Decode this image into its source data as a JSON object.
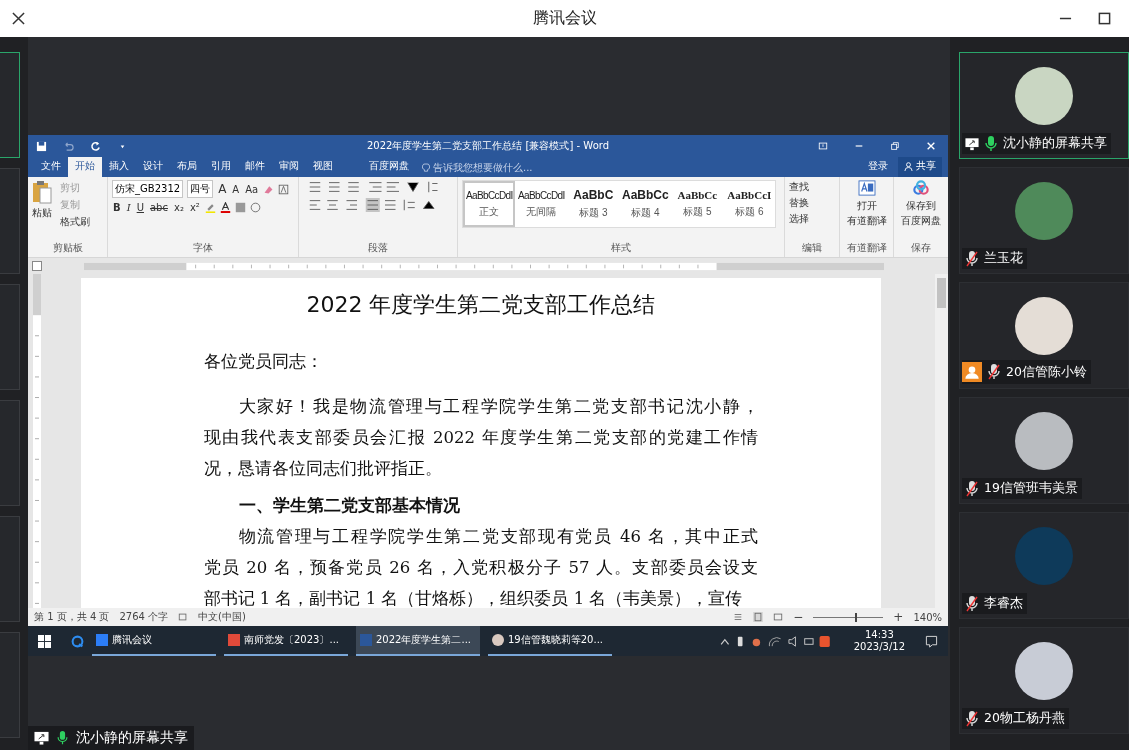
{
  "app": {
    "title": "腾讯会议"
  },
  "word": {
    "title": "2022年度学生第二党支部工作总结 [兼容模式] - Word",
    "tabs": [
      {
        "label": "文件",
        "selected": false
      },
      {
        "label": "开始",
        "selected": true
      },
      {
        "label": "插入",
        "selected": false
      },
      {
        "label": "设计",
        "selected": false
      },
      {
        "label": "布局",
        "selected": false
      },
      {
        "label": "引用",
        "selected": false
      },
      {
        "label": "邮件",
        "selected": false
      },
      {
        "label": "审阅",
        "selected": false
      },
      {
        "label": "视图",
        "selected": false
      },
      {
        "label": "百度网盘",
        "selected": false
      }
    ],
    "tell_me": {
      "placeholder": "告诉我您想要做什么..."
    },
    "sign_in": "登录",
    "share": "共享",
    "clipboard": {
      "paste": "粘贴",
      "items": [
        "剪切",
        "复制",
        "格式刷"
      ],
      "label": "剪贴板"
    },
    "font": {
      "name": "仿宋_GB2312",
      "size": "四号",
      "row1": [
        "A",
        "A",
        "Aa"
      ],
      "row2": [
        "B",
        "I",
        "U",
        "abc",
        "x₂",
        "x²"
      ],
      "label": "字体"
    },
    "paragraph": {
      "label": "段落"
    },
    "styles": {
      "items": [
        {
          "preview": "AaBbCcDdI",
          "name": "正文",
          "kind": "body",
          "selected": true
        },
        {
          "preview": "AaBbCcDdI",
          "name": "无间隔",
          "kind": "body",
          "selected": false
        },
        {
          "preview": "AaBbC",
          "name": "标题 3",
          "kind": "heading",
          "selected": false
        },
        {
          "preview": "AaBbCc",
          "name": "标题 4",
          "kind": "heading",
          "selected": false
        },
        {
          "preview": "AaBbCc",
          "name": "标题 5",
          "kind": "subheading",
          "selected": false
        },
        {
          "preview": "AaBbCcI",
          "name": "标题 6",
          "kind": "subheading",
          "selected": false
        }
      ],
      "label": "样式"
    },
    "editing": {
      "items": [
        "查找",
        "替换",
        "选择"
      ],
      "label": "编辑"
    },
    "translate": {
      "button": "打开",
      "sub": "有道翻译",
      "label": "有道翻译"
    },
    "save": {
      "button": "保存到",
      "sub": "百度网盘",
      "label": "保存"
    },
    "document": {
      "title": "2022 年度学生第二党支部工作总结",
      "paragraphs": [
        {
          "kind": "salutation",
          "lines": [
            "各位党员同志："
          ]
        },
        {
          "kind": "body",
          "lines": [
            "大家好！我是物流管理与工程学院学生第二党支部书记沈小静，",
            "现由我代表支部委员会汇报 2022 年度学生第二党支部的党建工作情",
            "况，恳请各位同志们批评指正。"
          ]
        },
        {
          "kind": "heading",
          "lines": [
            "一、学生第二党支部基本情况"
          ]
        },
        {
          "kind": "body",
          "lines": [
            "物流管理与工程学院学生第二党支部现有党员 46 名，其中正式",
            "党员 20 名，预备党员 26 名，入党积极分子 57 人。支部委员会设支",
            "部书记 1 名，副书记 1 名（甘烙栎），组织委员 1 名（韦美景），宣传"
          ]
        }
      ]
    },
    "status": {
      "page": "第 1 页，共 4 页",
      "words": "2764 个字",
      "language": "中文(中国)",
      "zoom": "140%",
      "zoom_out": "−",
      "zoom_in": "+",
      "zoom_level": {
        "level": 0.6
      }
    }
  },
  "taskbar": {
    "apps": [
      {
        "label": "腾讯会议",
        "kind": "meeting",
        "selected": false
      },
      {
        "label": "南师党发〔2023〕...",
        "kind": "pdf",
        "selected": false
      },
      {
        "label": "2022年度学生第二...",
        "kind": "word",
        "selected": true
      },
      {
        "label": "19信管魏晓莉等20...",
        "kind": "photo",
        "selected": false
      }
    ],
    "time": "14:33",
    "date": "2023/3/12"
  },
  "participants": [
    {
      "name": "沈小静的屏幕共享",
      "sharing": true,
      "muted": false,
      "person_badge": false,
      "selected": true,
      "color": "#c9d6c2"
    },
    {
      "name": "兰玉花",
      "sharing": false,
      "muted": true,
      "person_badge": false,
      "selected": false,
      "color": "#4f8a5a"
    },
    {
      "name": "20信管陈小铃",
      "sharing": false,
      "muted": true,
      "person_badge": true,
      "selected": false,
      "color": "#e4ddd6"
    },
    {
      "name": "19信管班韦美景",
      "sharing": false,
      "muted": true,
      "person_badge": false,
      "selected": false,
      "color": "#b9bcc0"
    },
    {
      "name": "李睿杰",
      "sharing": false,
      "muted": true,
      "person_badge": false,
      "selected": false,
      "color": "#0e3a5a"
    },
    {
      "name": "20物工杨丹燕",
      "sharing": false,
      "muted": true,
      "person_badge": false,
      "selected": false,
      "color": "#c8ccd6"
    }
  ],
  "share_label": {
    "name": "沈小静的屏幕共享",
    "muted": false
  }
}
